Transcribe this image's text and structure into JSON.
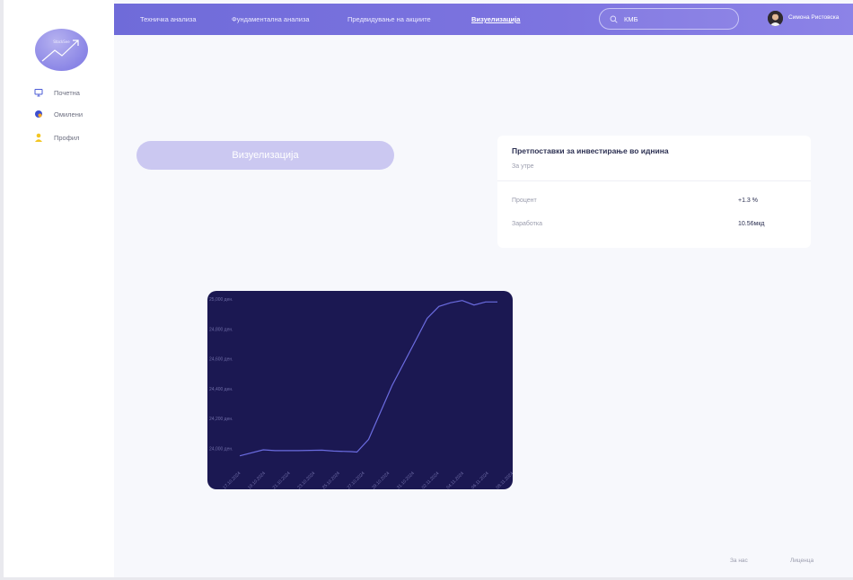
{
  "sidebar": {
    "logo_text": "StockSee",
    "items": [
      {
        "label": "Почетна",
        "icon": "monitor-icon"
      },
      {
        "label": "Омилени",
        "icon": "favorites-icon"
      },
      {
        "label": "Профил",
        "icon": "user-icon"
      }
    ]
  },
  "topbar": {
    "tabs": [
      {
        "label": "Техничка анализа",
        "active": false
      },
      {
        "label": "Фундаментална анализа",
        "active": false
      },
      {
        "label": "Предвидување на акциите",
        "active": false
      },
      {
        "label": "Визуелизација",
        "active": true
      }
    ],
    "search": {
      "value": "КМБ",
      "icon": "search-icon"
    },
    "user": {
      "name": "Симона Ристовска",
      "avatar": "user-avatar"
    }
  },
  "main": {
    "visualize_button": "Визуелизација",
    "prediction_card": {
      "title": "Претпоставки за инвестирање во иднина",
      "subtitle": "За утре",
      "rows": [
        {
          "label": "Процент",
          "value": "+1.3 %"
        },
        {
          "label": "Заработка",
          "value": "10.56мкд"
        }
      ]
    }
  },
  "chart_data": {
    "type": "line",
    "ylim": [
      23900,
      25000
    ],
    "yticks": [
      24000,
      24200,
      24400,
      24600,
      24800,
      25000
    ],
    "ytick_labels": [
      "24,000 ден.",
      "24,200 ден.",
      "24,400 ден.",
      "24,600 ден.",
      "24,800 ден.",
      "25,000 ден."
    ],
    "xtick_labels": [
      "17.10.2024",
      "19.10.2024",
      "21.10.2024",
      "23.10.2024",
      "25.10.2024",
      "27.10.2024",
      "29.10.2024",
      "31.10.2024",
      "02.11.2024",
      "04.11.2024",
      "06.11.2024",
      "08.11.2024"
    ],
    "series": [
      {
        "color": "#6b6ce0",
        "x": [
          1,
          3,
          4,
          6,
          8,
          9,
          10.5,
          11,
          12,
          14,
          16,
          17,
          18,
          19,
          20,
          21,
          22,
          23
        ],
        "y": [
          23950,
          23990,
          23985,
          23985,
          23988,
          23982,
          23978,
          23975,
          24060,
          24420,
          24720,
          24870,
          24950,
          24975,
          24990,
          24960,
          24980,
          24980
        ]
      }
    ],
    "x_range": [
      -1,
      24
    ]
  },
  "footer": {
    "about": "За нас",
    "license": "Лиценца"
  },
  "colors": {
    "accent": "#7d74e0",
    "chart_bg": "#1b1852",
    "line": "#6b6ce0"
  }
}
